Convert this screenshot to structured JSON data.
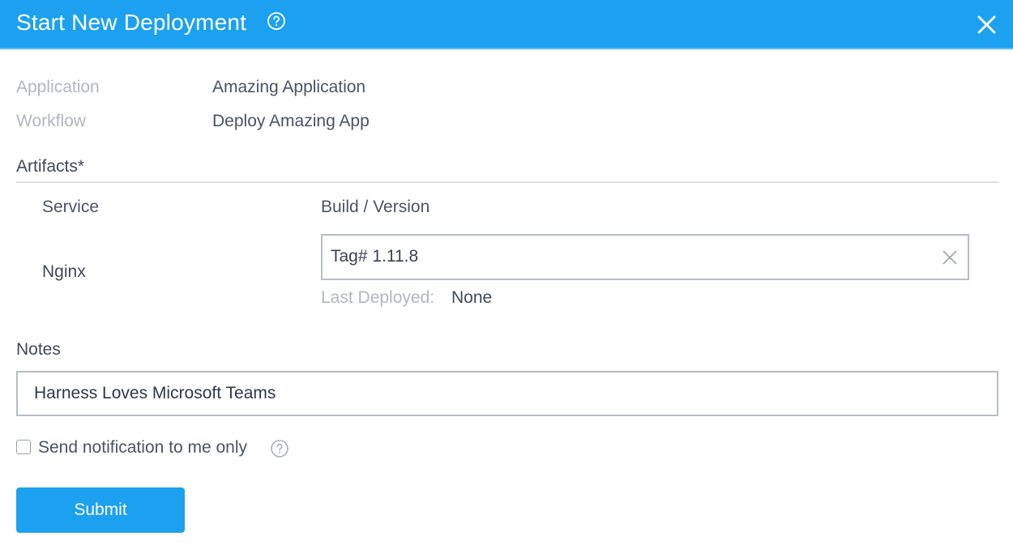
{
  "dialog": {
    "title": "Start New Deployment",
    "help_icon": "question-circle-icon",
    "close_icon": "close-icon",
    "accent_color": "#1ca1f0"
  },
  "meta": {
    "application_label": "Application",
    "application_value": "Amazing Application",
    "workflow_label": "Workflow",
    "workflow_value": "Deploy Amazing App"
  },
  "artifacts": {
    "title": "Artifacts*",
    "service_header": "Service",
    "build_header": "Build / Version",
    "rows": [
      {
        "service": "Nginx",
        "build_value": "Tag# 1.11.8",
        "last_deployed_label": "Last Deployed:",
        "last_deployed_value": "None"
      }
    ]
  },
  "notes": {
    "label": "Notes",
    "value": "Harness Loves Microsoft Teams"
  },
  "notification": {
    "label": "Send notification to me only",
    "checked": false
  },
  "actions": {
    "submit_label": "Submit"
  }
}
